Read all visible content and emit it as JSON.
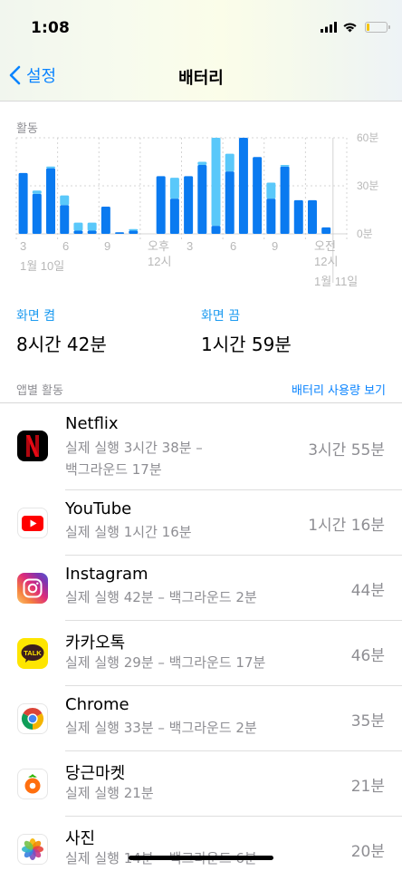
{
  "status_bar": {
    "time": "1:08"
  },
  "nav": {
    "back_label": "설정",
    "title": "배터리"
  },
  "chart_data": {
    "type": "bar",
    "title": "활동",
    "y_tick_labels": [
      "60분",
      "30분",
      "0분"
    ],
    "x_tick_labels": [
      "3",
      "6",
      "9",
      "오후",
      "12시",
      "3",
      "6",
      "9",
      "오전",
      "12시"
    ],
    "date_labels": [
      "1월 10일",
      "1월 11일"
    ],
    "ylim": [
      0,
      60
    ],
    "categories": [
      "1:00",
      "2:00",
      "3:00",
      "4:00",
      "5:00",
      "6:00",
      "7:00",
      "8:00",
      "9:00",
      "10:00",
      "11:00",
      "12:00",
      "13:00",
      "14:00",
      "15:00",
      "16:00",
      "17:00",
      "18:00",
      "19:00",
      "20:00",
      "21:00",
      "22:00",
      "23:00",
      "0:00"
    ],
    "series": [
      {
        "name": "Screen On",
        "values": [
          38,
          25,
          41,
          18,
          2,
          2,
          17,
          1,
          2,
          0,
          36,
          22,
          36,
          43,
          5,
          39,
          60,
          48,
          22,
          42,
          21,
          21,
          4,
          0
        ]
      },
      {
        "name": "Screen Off",
        "values": [
          0,
          2,
          1,
          6,
          5,
          5,
          0,
          0,
          1,
          0,
          0,
          13,
          0,
          2,
          55,
          11,
          0,
          0,
          10,
          1,
          0,
          0,
          0,
          0
        ]
      }
    ],
    "colors": {
      "screen_on": "#0a7af0",
      "screen_off": "#5ac8fa",
      "grid": "#d4d4d4",
      "label": "#b8b8b8"
    }
  },
  "screen_stats": {
    "on_label": "화면 켬",
    "on_value": "8시간 42분",
    "off_label": "화면 끔",
    "off_value": "1시간 59분"
  },
  "app_activity": {
    "title": "앱별 활동",
    "link_label": "배터리 사용량 보기",
    "apps": [
      {
        "name": "Netflix",
        "detail_1": "실제 실행 3시간 38분 –",
        "detail_2": "백그라운드 17분",
        "time": "3시간 55분",
        "icon": "netflix-icon"
      },
      {
        "name": "YouTube",
        "detail_1": "실제 실행 1시간 16분",
        "time": "1시간 16분",
        "icon": "youtube-icon"
      },
      {
        "name": "Instagram",
        "detail_1": "실제 실행 42분 – 백그라운드 2분",
        "time": "44분",
        "icon": "instagram-icon"
      },
      {
        "name": "카카오톡",
        "detail_1": "실제 실행 29분 – 백그라운드 17분",
        "time": "46분",
        "icon": "kakaotalk-icon",
        "icon_text": "TALK"
      },
      {
        "name": "Chrome",
        "detail_1": "실제 실행 33분 – 백그라운드 2분",
        "time": "35분",
        "icon": "chrome-icon"
      },
      {
        "name": "당근마켓",
        "detail_1": "실제 실행 21분",
        "time": "21분",
        "icon": "daangn-icon"
      },
      {
        "name": "사진",
        "detail_1": "실제 실행 14분 – 백그라운드 6분",
        "time": "20분",
        "icon": "photos-icon"
      }
    ]
  }
}
